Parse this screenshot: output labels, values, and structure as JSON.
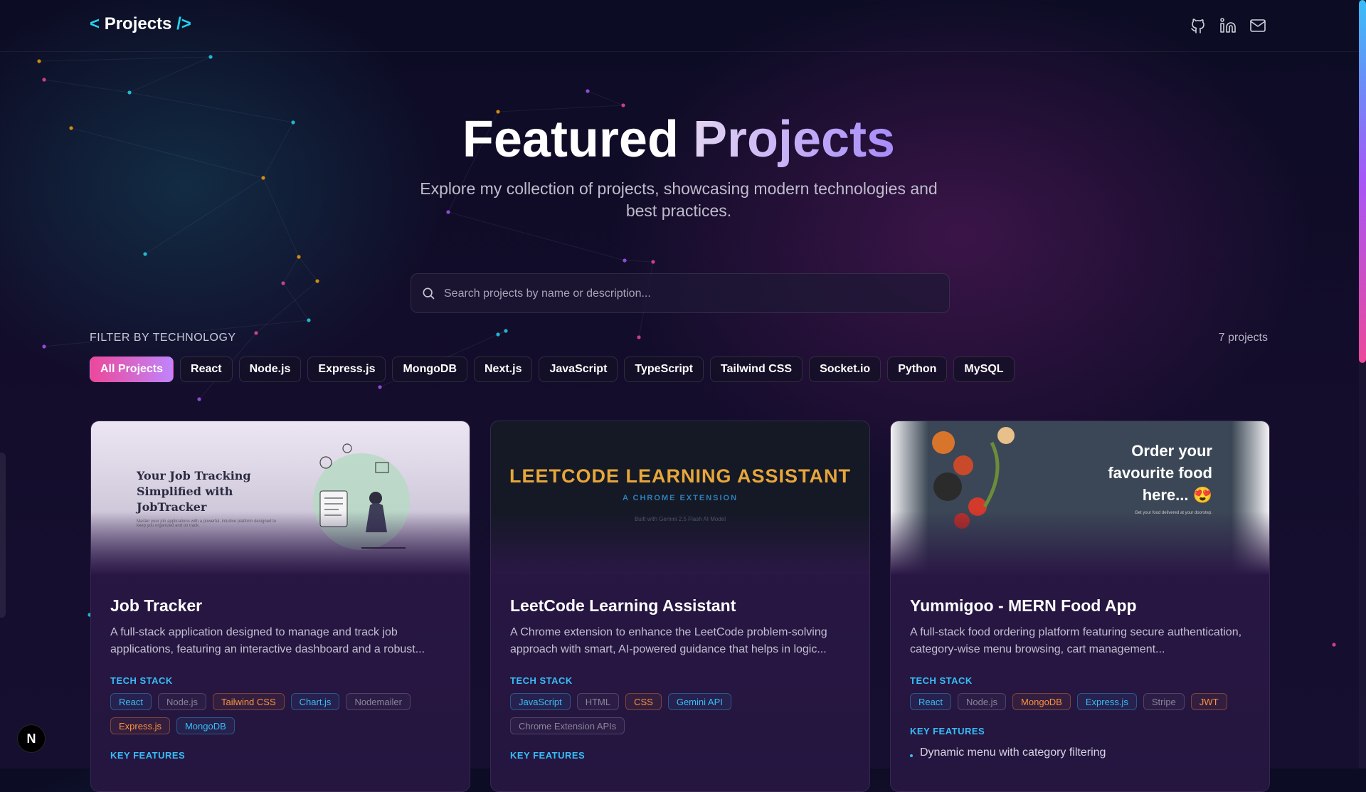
{
  "header": {
    "brand_open": "<",
    "brand_text": "Projects",
    "brand_close": "/>",
    "social": [
      "github-icon",
      "linkedin-icon",
      "mail-icon"
    ]
  },
  "hero": {
    "title_1": "Featured",
    "title_2": "Projects",
    "subtitle": "Explore my collection of projects, showcasing modern technologies and best practices."
  },
  "search": {
    "placeholder": "Search projects by name or description..."
  },
  "filters": {
    "label": "FILTER BY TECHNOLOGY",
    "count": "7 projects",
    "chips": [
      "All Projects",
      "React",
      "Node.js",
      "Express.js",
      "MongoDB",
      "Next.js",
      "JavaScript",
      "TypeScript",
      "Tailwind CSS",
      "Socket.io",
      "Python",
      "MySQL"
    ],
    "active": "All Projects"
  },
  "cards": [
    {
      "thumb_title": "Your Job Tracking Simplified with JobTracker",
      "thumb_sub": "Master your job applications with a powerful, intuitive platform designed to keep you organized and on track.",
      "title": "Job Tracker",
      "desc": "A full-stack application designed to manage and track job applications, featuring an interactive dashboard and a robust...",
      "tech_label": "TECH STACK",
      "tags": [
        {
          "text": "React",
          "tone": "cyan"
        },
        {
          "text": "Node.js",
          "tone": "gray"
        },
        {
          "text": "Tailwind CSS",
          "tone": "orange"
        },
        {
          "text": "Chart.js",
          "tone": "cyan"
        },
        {
          "text": "Nodemailer",
          "tone": "gray"
        },
        {
          "text": "Express.js",
          "tone": "orange"
        },
        {
          "text": "MongoDB",
          "tone": "cyan"
        }
      ],
      "features_label": "KEY FEATURES",
      "features": []
    },
    {
      "thumb_title": "LEETCODE LEARNING ASSISTANT",
      "thumb_sub": "A CHROME EXTENSION",
      "thumb_foot": "Built with Gemini 2.5 Flash AI Model",
      "title": "LeetCode Learning Assistant",
      "desc": "A Chrome extension to enhance the LeetCode problem-solving approach with smart, AI-powered guidance that helps in logic...",
      "tech_label": "TECH STACK",
      "tags": [
        {
          "text": "JavaScript",
          "tone": "cyan"
        },
        {
          "text": "HTML",
          "tone": "gray"
        },
        {
          "text": "CSS",
          "tone": "orange"
        },
        {
          "text": "Gemini API",
          "tone": "cyan"
        },
        {
          "text": "Chrome Extension APIs",
          "tone": "gray"
        }
      ],
      "features_label": "KEY FEATURES",
      "features": []
    },
    {
      "thumb_title": "Order your favourite food here... 😍",
      "thumb_sub": "Get your food delivered at your doorstep.",
      "title": "Yummigoo - MERN Food App",
      "desc": "A full-stack food ordering platform featuring secure authentication, category-wise menu browsing, cart management...",
      "tech_label": "TECH STACK",
      "tags": [
        {
          "text": "React",
          "tone": "cyan"
        },
        {
          "text": "Node.js",
          "tone": "gray"
        },
        {
          "text": "MongoDB",
          "tone": "orange"
        },
        {
          "text": "Express.js",
          "tone": "cyan"
        },
        {
          "text": "Stripe",
          "tone": "gray"
        },
        {
          "text": "JWT",
          "tone": "orange"
        }
      ],
      "features_label": "KEY FEATURES",
      "features": [
        "Dynamic menu with category filtering"
      ]
    }
  ],
  "badge": "N"
}
